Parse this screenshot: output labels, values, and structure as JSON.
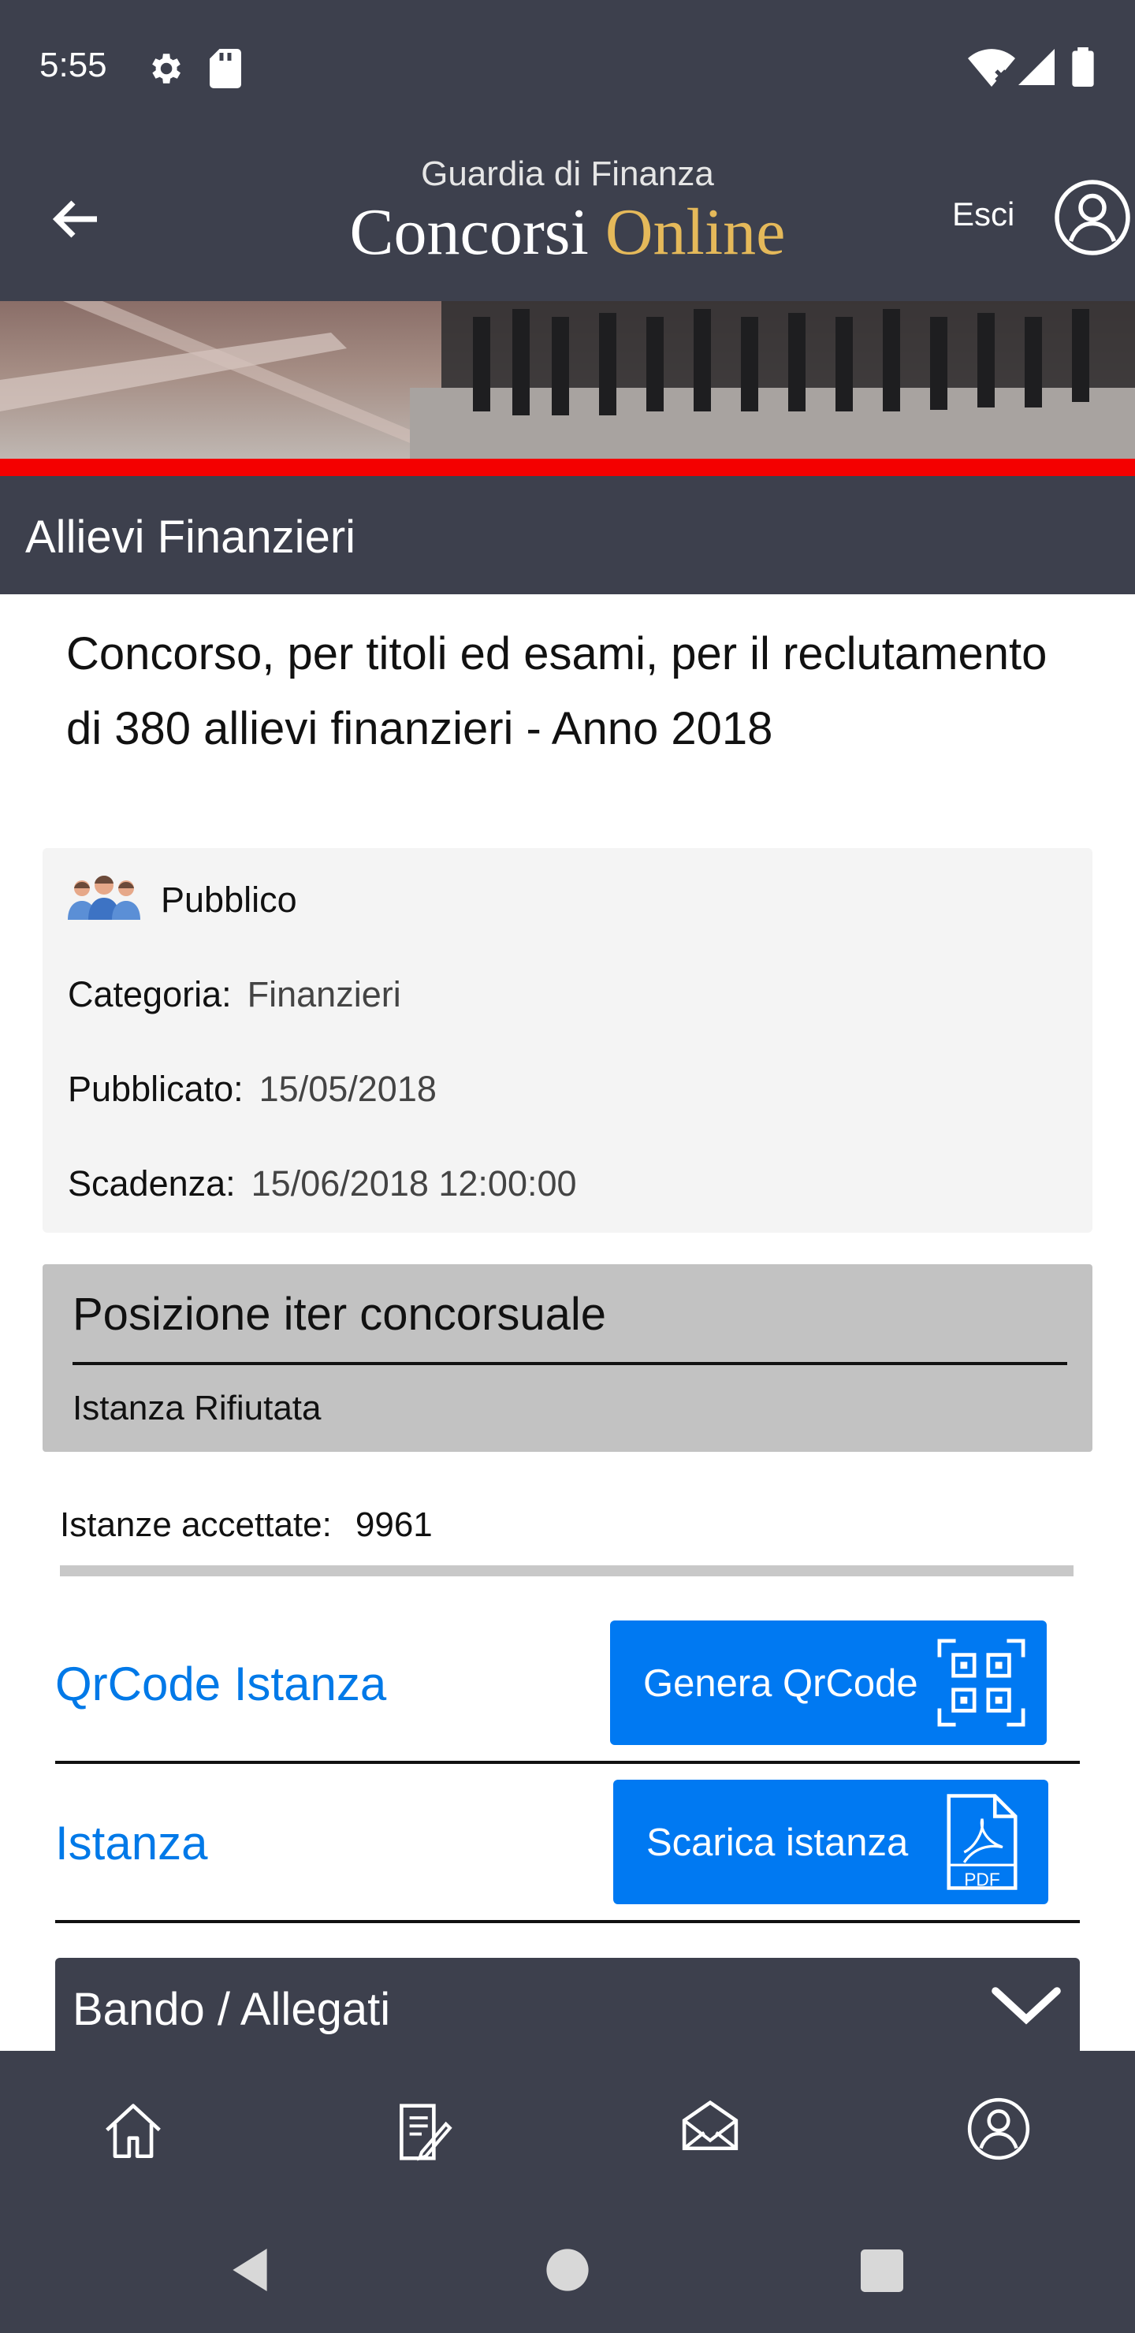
{
  "status_bar": {
    "time": "5:55"
  },
  "header": {
    "brand_top": "Guardia di Finanza",
    "brand_main_prefix": "Concorsi ",
    "brand_main_o": "O",
    "brand_main_suffix": "nline",
    "logout_label": "Esci"
  },
  "section": {
    "title": "Allievi Finanzieri"
  },
  "competition": {
    "description": "Concorso, per titoli ed esami, per il reclutamento di 380 allievi finanzieri - Anno 2018",
    "visibility": "Pubblico",
    "category_label": "Categoria:",
    "category_value": "Finanzieri",
    "published_label": "Pubblicato:",
    "published_value": "15/05/2018",
    "deadline_label": "Scadenza:",
    "deadline_value": "15/06/2018 12:00:00"
  },
  "position": {
    "title": "Posizione iter concorsuale",
    "status": "Istanza Rifiutata"
  },
  "accepted": {
    "label": "Istanze accettate:",
    "count": "9961"
  },
  "actions": [
    {
      "label": "QrCode Istanza",
      "button": "Genera QrCode",
      "icon": "qr-code-icon"
    },
    {
      "label": "Istanza",
      "button": "Scarica istanza",
      "icon": "pdf-icon",
      "icon_text": "PDF"
    }
  ],
  "accordion": {
    "label": "Bando / Allegati"
  },
  "bottom_nav": [
    {
      "icon": "home-icon"
    },
    {
      "icon": "document-sign-icon"
    },
    {
      "icon": "mail-icon"
    },
    {
      "icon": "user-icon"
    }
  ],
  "colors": {
    "header_bg": "#3d404d",
    "accent_blue": "#0079f2",
    "link_blue": "#0079e8",
    "red_band": "#f40000",
    "brand_gold": "#e5b95a"
  }
}
